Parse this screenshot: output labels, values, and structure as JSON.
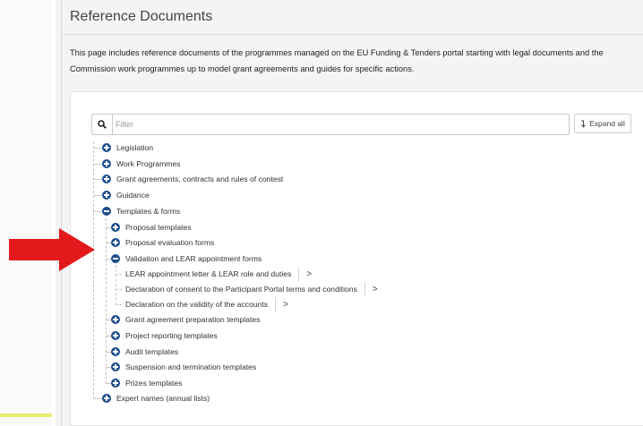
{
  "page": {
    "title": "Reference Documents",
    "intro_line1": "This page includes reference documents of the programmes managed on the EU Funding & Tenders portal starting with legal documents and the",
    "intro_line2": "Commission work programmes up to model grant agreements and guides for specific actions."
  },
  "search": {
    "placeholder": "Filter",
    "icon": "search-icon"
  },
  "toolbar": {
    "expand_all_label": "Expand all",
    "expand_icon": "expand-arrow-icon"
  },
  "colors": {
    "toggle": "#1f4e8c",
    "annotation_arrow": "#e3191b",
    "background": "#f4f4f4"
  },
  "tree": {
    "legislation": "Legislation",
    "work_programmes": "Work Programmes",
    "grant_agreements": "Grant agreements, contracts and rules of contest",
    "guidance": "Guidance",
    "templates_forms": "Templates & forms",
    "proposal_templates": "Proposal templates",
    "proposal_evaluation_forms": "Proposal evaluation forms",
    "validation_lear": "Validation and LEAR appointment forms",
    "lear_letter": "LEAR appointment letter & LEAR role and duties",
    "declaration_consent": "Declaration of consent to the Participant Portal terms and conditions",
    "declaration_validity": "Declaration on the validity of the accounts",
    "grant_agreement_prep": "Grant agreement preparation templates",
    "project_reporting": "Project reporting templates",
    "audit_templates": "Audit templates",
    "suspension_termination": "Suspension and termination templates",
    "prizes_templates": "Prizes templates",
    "expert_names": "Expert names (annual lists)",
    "chevron": ">"
  }
}
